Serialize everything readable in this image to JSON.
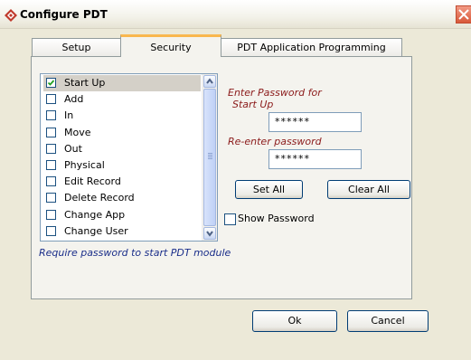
{
  "window": {
    "title": "Configure PDT",
    "icon": "app-diamond-icon",
    "close_icon": "close-icon"
  },
  "tabs": [
    {
      "label": "Setup"
    },
    {
      "label": "Security"
    },
    {
      "label": "PDT Application Programming"
    }
  ],
  "permissions": {
    "items": [
      {
        "label": "Start Up",
        "checked": true
      },
      {
        "label": "Add",
        "checked": false
      },
      {
        "label": "In",
        "checked": false
      },
      {
        "label": "Move",
        "checked": false
      },
      {
        "label": "Out",
        "checked": false
      },
      {
        "label": "Physical",
        "checked": false
      },
      {
        "label": "Edit Record",
        "checked": false
      },
      {
        "label": "Delete Record",
        "checked": false
      },
      {
        "label": "Change App",
        "checked": false
      },
      {
        "label": "Change User",
        "checked": false
      }
    ]
  },
  "password": {
    "enter_label_line1": "Enter Password for",
    "enter_label_line2": "Start Up",
    "enter_value": "******",
    "reenter_label": "Re-enter password",
    "reenter_value": "******"
  },
  "buttons": {
    "set_all": "Set All",
    "clear_all": "Clear All",
    "ok": "Ok",
    "cancel": "Cancel"
  },
  "show_password": {
    "label": "Show Password",
    "checked": false
  },
  "hint": "Require password to start PDT module",
  "colors": {
    "accent_tab": "#f9b74e",
    "label_red": "#8b1a1a",
    "hint_blue": "#1a2e8a"
  }
}
